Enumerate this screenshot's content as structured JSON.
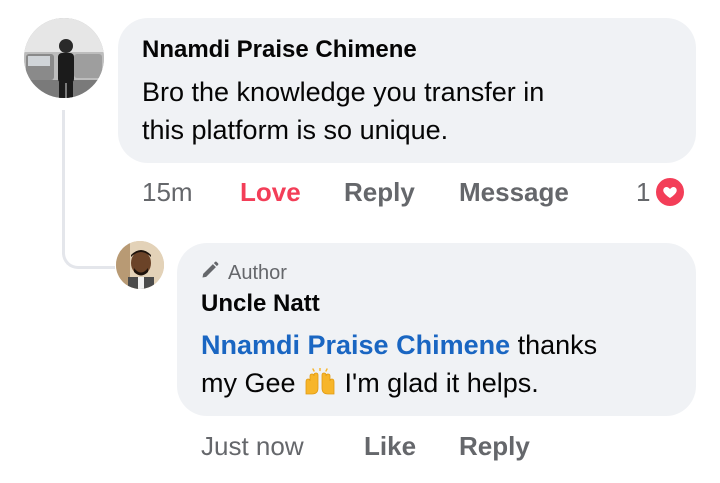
{
  "comment": {
    "author": "Nnamdi Praise Chimene",
    "text_line1": "Bro the knowledge you transfer in",
    "text_line2": "this platform is so unique.",
    "time": "15m",
    "reaction_label": "Love",
    "reply_label": "Reply",
    "message_label": "Message",
    "reaction_count": "1",
    "reaction_icon": "heart-icon"
  },
  "reply": {
    "badge": "Author",
    "badge_icon": "pencil-icon",
    "author": "Uncle Natt",
    "mention": "Nnamdi Praise Chimene",
    "text_after_mention": " thanks",
    "text_line2_before_emoji": "my Gee ",
    "emoji": "raising-hands-emoji",
    "text_line2_after_emoji": " I'm glad it helps.",
    "time": "Just now",
    "like_label": "Like",
    "reply_label": "Reply"
  },
  "colors": {
    "bubble": "#f0f2f5",
    "love": "#f33e58",
    "mention": "#1a66c2",
    "secondary_text": "#65676b"
  }
}
